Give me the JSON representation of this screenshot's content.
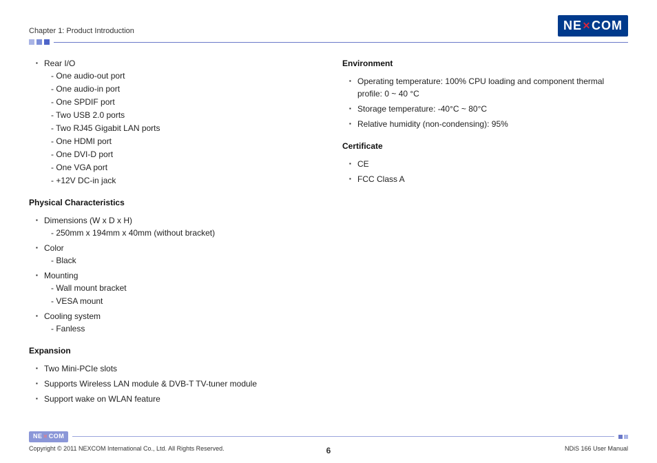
{
  "header": {
    "chapter": "Chapter 1: Product Introduction",
    "logo_left": "NE",
    "logo_right": "COM"
  },
  "left": {
    "rear_io": {
      "label": "Rear I/O",
      "items": [
        "- One audio-out port",
        "- One audio-in port",
        "- One SPDIF port",
        "- Two USB 2.0 ports",
        "- Two RJ45 Gigabit LAN ports",
        "- One HDMI port",
        "- One DVI-D port",
        "- One VGA port",
        "- +12V DC-in jack"
      ]
    },
    "physical": {
      "heading": "Physical Characteristics",
      "items": [
        {
          "label": "Dimensions (W x D x H)",
          "subs": [
            "- 250mm x 194mm x 40mm (without bracket)"
          ]
        },
        {
          "label": "Color",
          "subs": [
            "- Black"
          ]
        },
        {
          "label": "Mounting",
          "subs": [
            "- Wall mount bracket",
            "- VESA mount"
          ]
        },
        {
          "label": "Cooling system",
          "subs": [
            "- Fanless"
          ]
        }
      ]
    },
    "expansion": {
      "heading": "Expansion",
      "items": [
        "Two Mini-PCIe slots",
        "Supports Wireless LAN module & DVB-T TV-tuner module",
        "Support wake on WLAN feature"
      ]
    }
  },
  "right": {
    "environment": {
      "heading": "Environment",
      "items": [
        "Operating temperature: 100% CPU loading and component thermal profile: 0 ~ 40 °C",
        "Storage temperature: -40°C ~ 80°C",
        "Relative humidity (non-condensing): 95%"
      ]
    },
    "certificate": {
      "heading": "Certificate",
      "items": [
        "CE",
        "FCC Class A"
      ]
    }
  },
  "footer": {
    "copyright": "Copyright © 2011 NEXCOM International Co., Ltd. All Rights Reserved.",
    "page": "6",
    "doc": "NDiS 166 User Manual",
    "logo_left": "NE",
    "logo_right": "COM"
  }
}
